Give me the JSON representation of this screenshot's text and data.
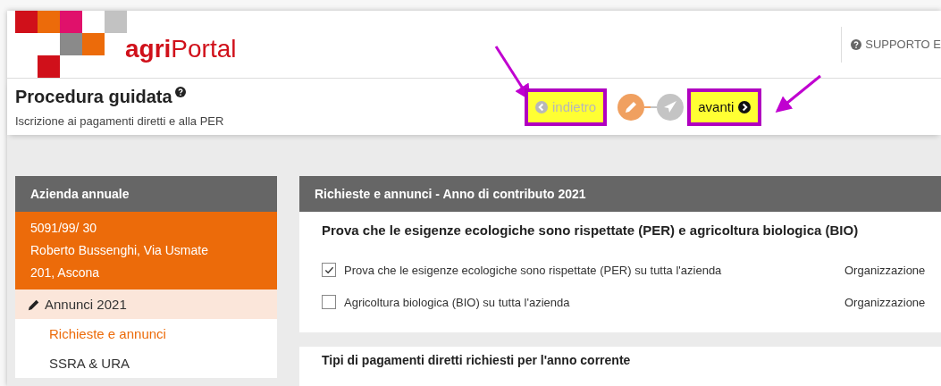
{
  "header": {
    "logo_text": "**agri**Portal",
    "support_link": "SUPPORTO E"
  },
  "wizard": {
    "title": "Procedura guidata",
    "subtitle": "Iscrizione ai pagamenti diretti e alla PER",
    "back": {
      "label": "indietro",
      "disabled": true,
      "highlighted": true
    },
    "steps": [
      {
        "kind": "edit",
        "active": true
      },
      {
        "kind": "send",
        "active": false
      }
    ],
    "next": {
      "label": "avanti",
      "disabled": false,
      "highlighted": true
    }
  },
  "sidebar": {
    "title": "Azienda annuale",
    "farm_lines": [
      "5091/99/ 30",
      "Roberto Bussenghi, Via Usmate",
      "201, Ascona"
    ],
    "items": [
      {
        "kind": "section",
        "label": "Annunci 2021",
        "selected": false
      },
      {
        "kind": "item",
        "label": "Richieste e annunci",
        "selected": true
      },
      {
        "kind": "item",
        "label": "SSRA & URA",
        "selected": false
      }
    ]
  },
  "main": {
    "panel_title": "Richieste e annunci - Anno di contributo 2021",
    "section_title": "Prova che le esigenze ecologiche sono rispettate (PER) e agricoltura biologica (BIO)",
    "options": [
      {
        "label": "Prova che le esigenze ecologiche sono rispettate (PER) su tutta l'azienda",
        "checked": true,
        "column_2": "Organizzazione"
      },
      {
        "label": "Agricoltura biologica (BIO) su tutta l'azienda",
        "checked": false,
        "column_2": "Organizzazione"
      }
    ],
    "next_section_title": "Tipi di pagamenti diretti richiesti per l'anno corrente"
  }
}
